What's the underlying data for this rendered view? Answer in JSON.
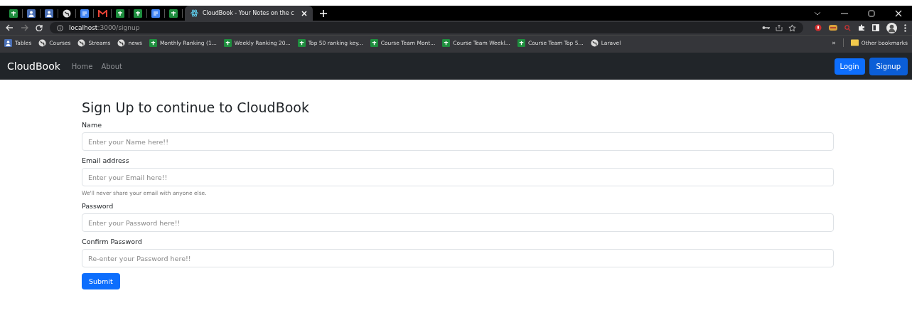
{
  "browser": {
    "pinned_tabs": [
      {
        "kind": "sheets"
      },
      {
        "kind": "contacts"
      },
      {
        "kind": "contacts"
      },
      {
        "kind": "globe"
      },
      {
        "kind": "docs"
      },
      {
        "kind": "mail"
      },
      {
        "kind": "sheets"
      },
      {
        "kind": "sheets"
      },
      {
        "kind": "docs"
      },
      {
        "kind": "sheets"
      }
    ],
    "active_tab": {
      "title": "CloudBook - Your Notes on the c"
    },
    "address": {
      "host": "localhost",
      "path": ":3000/signup"
    },
    "bookmarks": [
      {
        "kind": "contacts",
        "label": "Tables"
      },
      {
        "kind": "globe",
        "label": "Courses"
      },
      {
        "kind": "globe",
        "label": "Streams"
      },
      {
        "kind": "globe",
        "label": "news"
      },
      {
        "kind": "sheets",
        "label": "Monthly Ranking (1..."
      },
      {
        "kind": "sheets",
        "label": "Weekly Ranking 20..."
      },
      {
        "kind": "sheets",
        "label": "Top 50 ranking key..."
      },
      {
        "kind": "sheets",
        "label": "Course Team Mont..."
      },
      {
        "kind": "sheets",
        "label": "Course Team Weekl..."
      },
      {
        "kind": "sheets",
        "label": "Course Team Top 5..."
      },
      {
        "kind": "globe",
        "label": "Laravel"
      }
    ],
    "overflow": "»",
    "other_bookmarks": "Other bookmarks"
  },
  "navbar": {
    "brand": "CloudBook",
    "links": [
      "Home",
      "About"
    ],
    "buttons": [
      "Login",
      "Signup"
    ]
  },
  "form": {
    "title": "Sign Up to continue to CloudBook",
    "fields": [
      {
        "label": "Name",
        "placeholder": "Enter your Name here!!"
      },
      {
        "label": "Email address",
        "placeholder": "Enter your Email here!!",
        "help": "We'll never share your email with anyone else."
      },
      {
        "label": "Password",
        "placeholder": "Enter your Password here!!"
      },
      {
        "label": "Confirm Password",
        "placeholder": "Re-enter your Password here!!"
      }
    ],
    "submit": "Submit"
  }
}
